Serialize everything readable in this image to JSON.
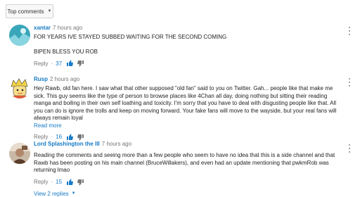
{
  "sort": {
    "label": "Top comments"
  },
  "comments": [
    {
      "author": "xantar",
      "time": "7 hours ago",
      "paragraphs": [
        "FOR YEARS IVE STAYED SUBBED WAITING FOR THE SECOND COMING",
        "BIPEN BLESS YOU ROB"
      ],
      "read_more": "",
      "reply_label": "Reply",
      "separator": "·",
      "likes": "37",
      "avatar_colors": {
        "bg": "#3aa6b9",
        "accent": "#88d4e0"
      }
    },
    {
      "author": "Rusp",
      "time": "2 hours ago",
      "paragraphs": [
        "Hey Rawb, old fan here. I saw what that other supposed \"old fan\" said to you on Twitter. Gah... people like that make me sick. This guy seems like the type of person to browse places like 4Chan all day, doing nothing but sitting their reading manga and boiling in their own self loathing and toxicity. I'm sorry that you have to deal with disgusting people like that. All you can do is ignore the trolls and keep on moving forward. Your fake fans will move to the wayside, but your real fans will always remain loyal"
      ],
      "read_more": "Read more",
      "reply_label": "Reply",
      "separator": "·",
      "likes": "16",
      "avatar_colors": {
        "bg": "#f3d34a",
        "accent": "#e05a3a"
      }
    },
    {
      "author": "Lord Splashington the III",
      "time": "7 hours ago",
      "paragraphs": [
        "Reading the comments and seeing more than a few people who seem to have no idea that this is a side channel and that Rawb has been posting on his main channel (BruceWillakers), and even had an update mentioning that pwkmRob was returning lmao"
      ],
      "read_more": "",
      "reply_label": "Reply",
      "separator": "·",
      "likes": "15",
      "view_replies": "View 2 replies",
      "avatar_colors": {
        "bg": "#c9b8a6",
        "accent": "#5a3d2a"
      }
    }
  ],
  "colors": {
    "link": "#167ac6",
    "muted": "#767676",
    "text": "#222222"
  },
  "icons": {
    "like": "thumb-up-icon",
    "dislike": "thumb-down-icon",
    "menu": "more-vert-icon"
  }
}
